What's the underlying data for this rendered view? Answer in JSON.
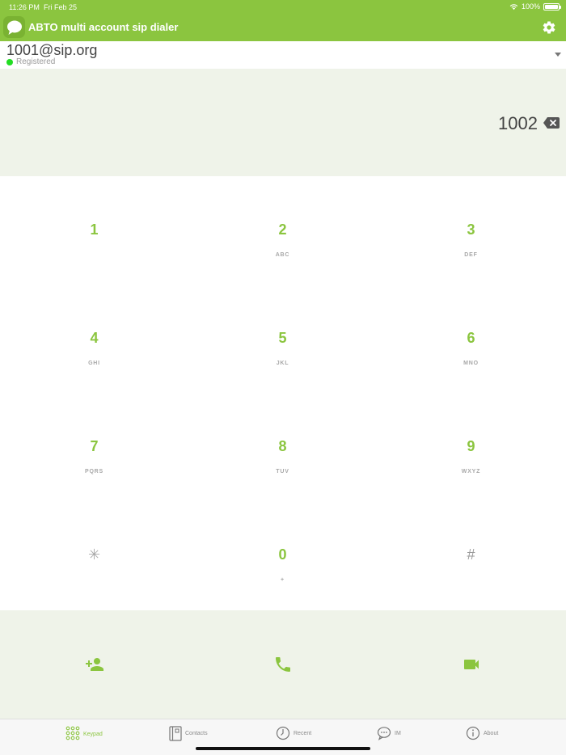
{
  "status_bar": {
    "time": "11:26 PM",
    "date": "Fri Feb 25",
    "battery": "100%"
  },
  "app": {
    "title": "ABTO multi account sip dialer",
    "logo_icon": "chat-bubble-icon",
    "settings_icon": "gear-icon"
  },
  "account": {
    "name": "1001@sip.org",
    "status": "Registered",
    "status_color": "#22dd22"
  },
  "display": {
    "number": "1002"
  },
  "keypad": {
    "keys": [
      {
        "digit": "1",
        "letters": ""
      },
      {
        "digit": "2",
        "letters": "ABC"
      },
      {
        "digit": "3",
        "letters": "DEF"
      },
      {
        "digit": "4",
        "letters": "GHI"
      },
      {
        "digit": "5",
        "letters": "JKL"
      },
      {
        "digit": "6",
        "letters": "MNO"
      },
      {
        "digit": "7",
        "letters": "PQRS"
      },
      {
        "digit": "8",
        "letters": "TUV"
      },
      {
        "digit": "9",
        "letters": "WXYZ"
      },
      {
        "digit": "✳",
        "letters": ""
      },
      {
        "digit": "0",
        "letters": "+"
      },
      {
        "digit": "#",
        "letters": ""
      }
    ]
  },
  "actions": [
    {
      "name": "add-contact",
      "icon": "add-person-icon"
    },
    {
      "name": "audio-call",
      "icon": "phone-icon"
    },
    {
      "name": "video-call",
      "icon": "video-camera-icon"
    }
  ],
  "tabs": [
    {
      "label": "Keypad",
      "icon": "keypad-icon",
      "active": true
    },
    {
      "label": "Contacts",
      "icon": "contacts-book-icon",
      "active": false
    },
    {
      "label": "Recent",
      "icon": "clock-icon",
      "active": false
    },
    {
      "label": "IM",
      "icon": "chat-icon",
      "active": false
    },
    {
      "label": "About",
      "icon": "info-icon",
      "active": false
    }
  ],
  "colors": {
    "accent": "#8bc53f",
    "panel": "#eff3e9"
  }
}
